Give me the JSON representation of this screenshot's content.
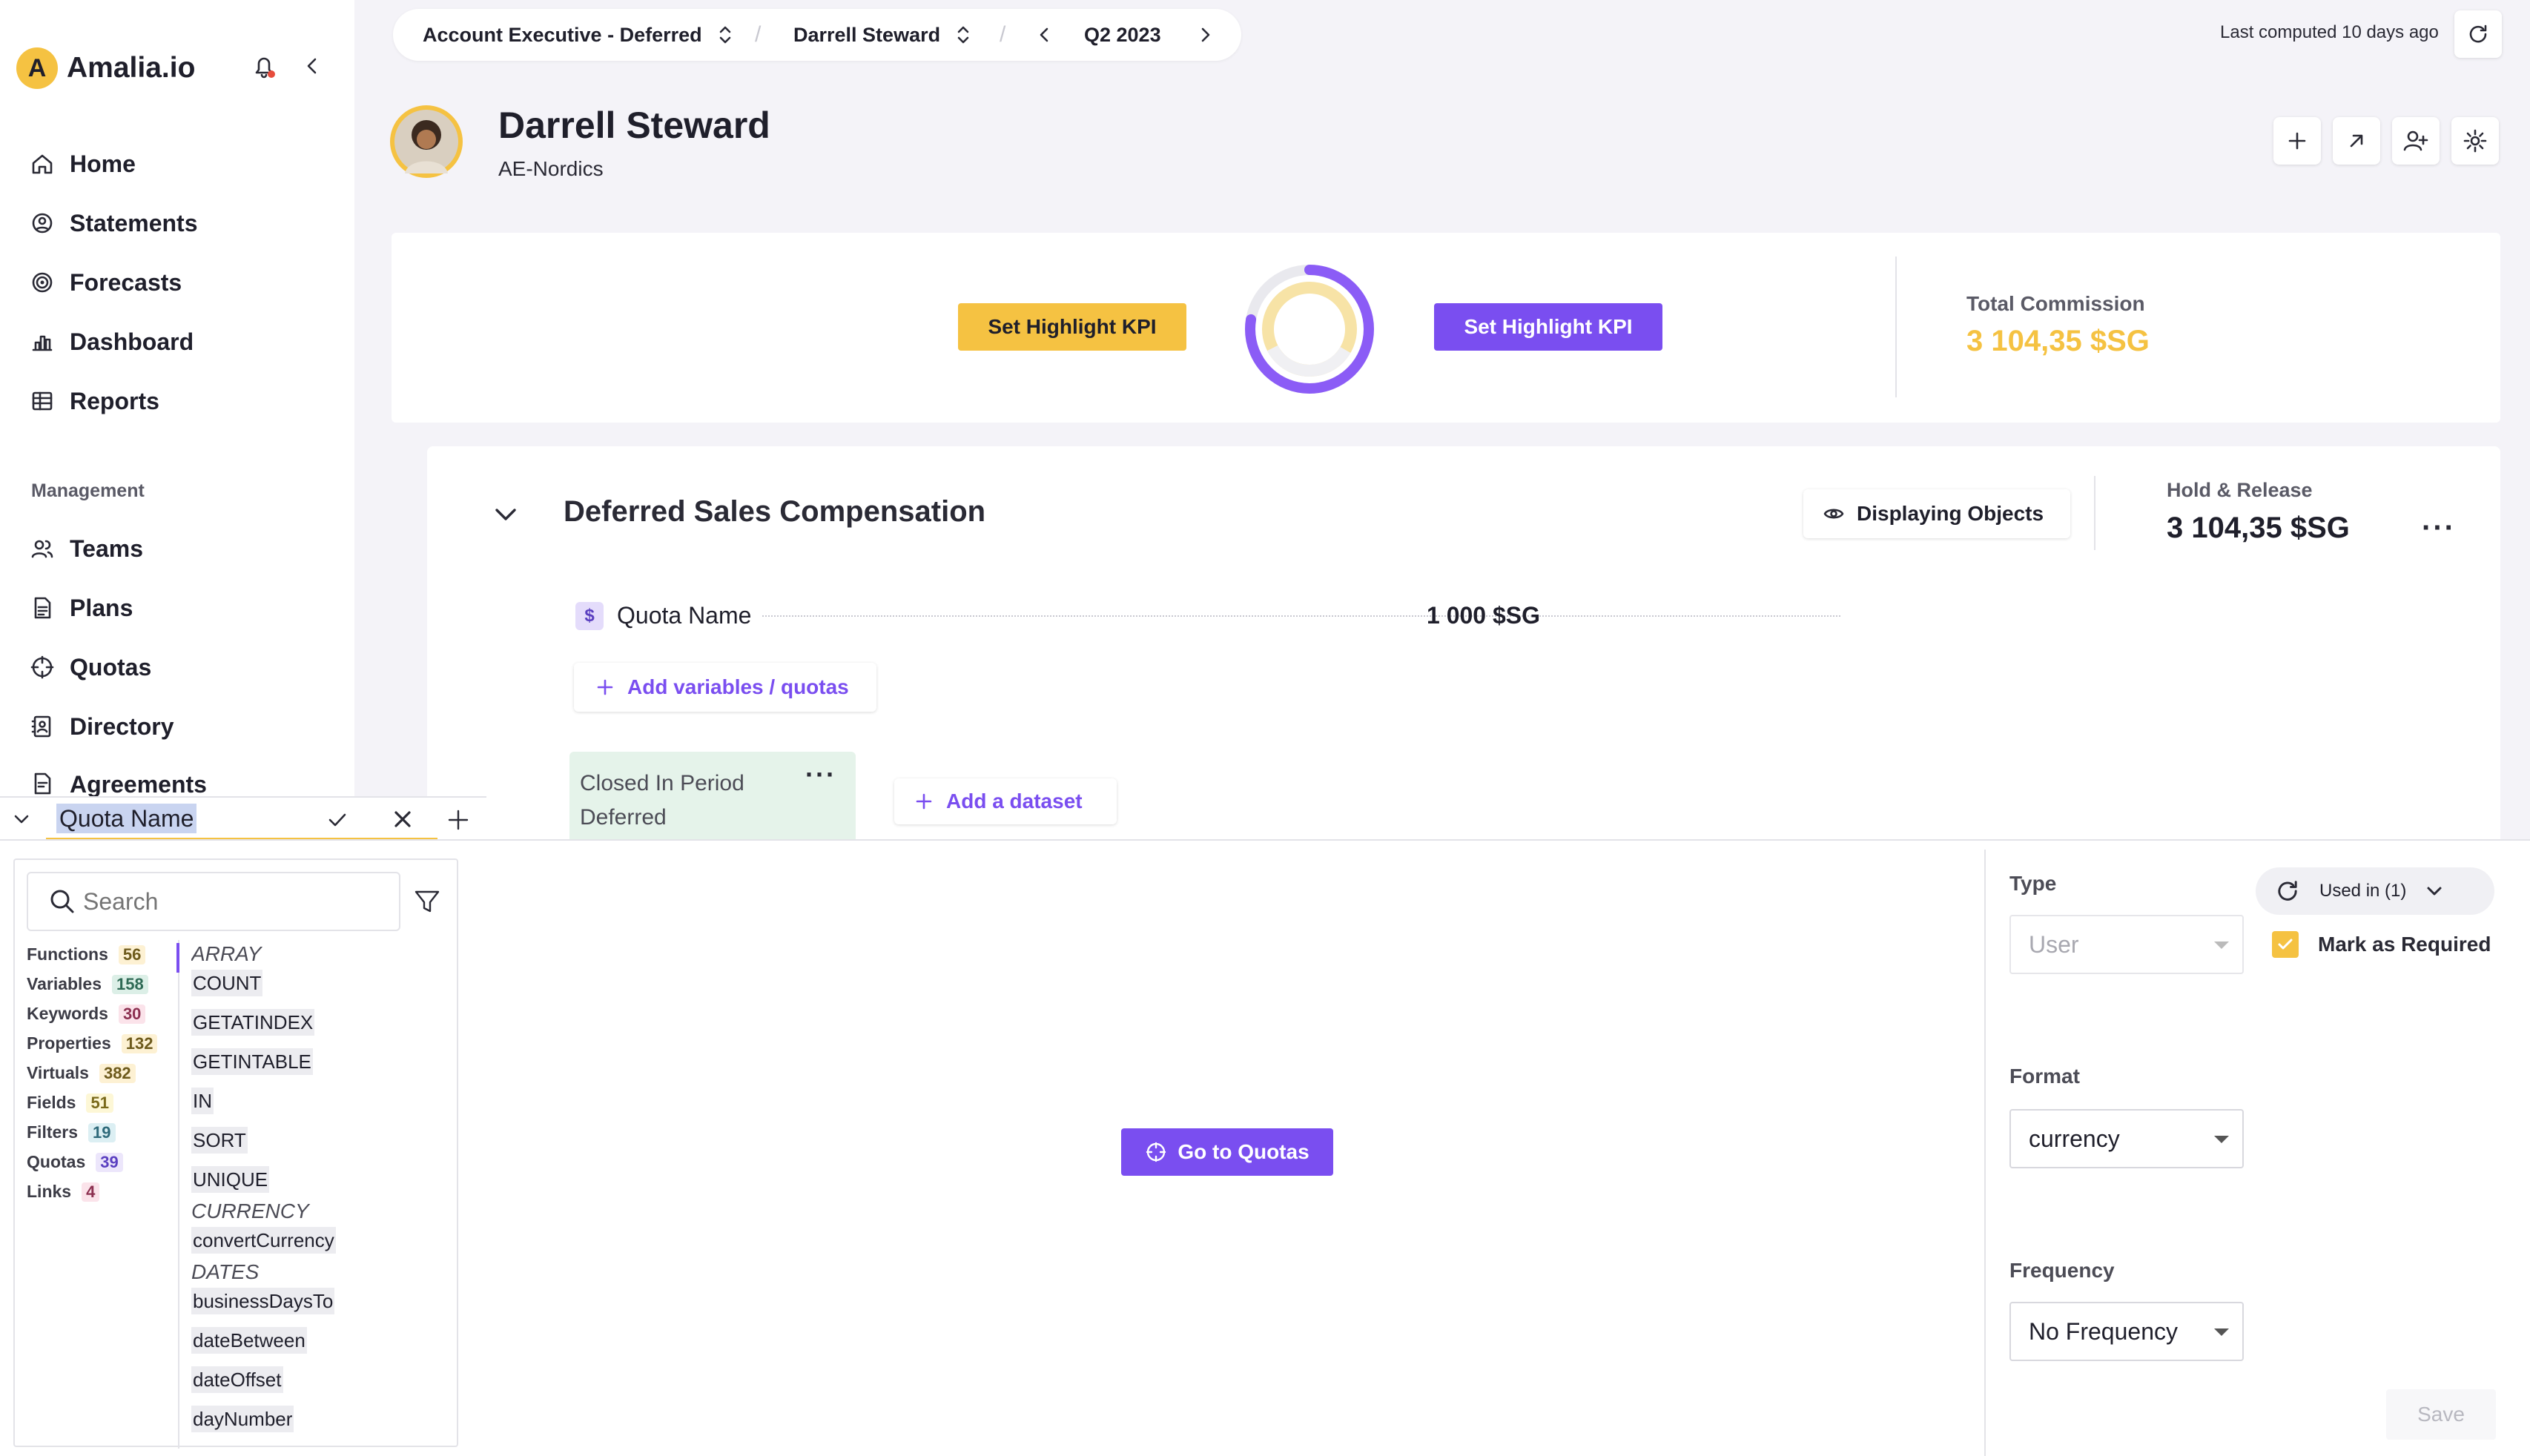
{
  "app": {
    "name": "Amalia.io",
    "logo_letter": "A",
    "accent": "#f5c242",
    "primary": "#7a4ef0"
  },
  "sidebar": {
    "items": [
      {
        "label": "Home",
        "icon": "home-icon"
      },
      {
        "label": "Statements",
        "icon": "user-circle-icon"
      },
      {
        "label": "Forecasts",
        "icon": "forecast-icon"
      },
      {
        "label": "Dashboard",
        "icon": "bar-chart-icon"
      },
      {
        "label": "Reports",
        "icon": "table-icon"
      }
    ],
    "section_label": "Management",
    "management_items": [
      {
        "label": "Teams",
        "icon": "users-icon"
      },
      {
        "label": "Plans",
        "icon": "document-icon"
      },
      {
        "label": "Quotas",
        "icon": "target-icon"
      },
      {
        "label": "Directory",
        "icon": "contacts-icon"
      },
      {
        "label": "Agreements",
        "icon": "agreement-icon"
      }
    ]
  },
  "topbar": {
    "plan": "Account Executive - Deferred",
    "user": "Darrell Steward",
    "period": "Q2 2023",
    "last_computed": "Last computed 10 days ago"
  },
  "header": {
    "name": "Darrell Steward",
    "team": "AE-Nordics"
  },
  "kpi": {
    "set_kpi_left": "Set Highlight KPI",
    "set_kpi_right": "Set Highlight KPI",
    "total_commission_label": "Total Commission",
    "total_commission_value": "3 104,35 $SG"
  },
  "plan_card": {
    "title": "Deferred Sales Compensation",
    "displaying_objects": "Displaying Objects",
    "hold_release_label": "Hold & Release",
    "hold_release_value": "3 104,35 $SG",
    "quota_icon": "$",
    "quota_name": "Quota Name",
    "quota_value": "1 000 $SG",
    "add_variables": "Add variables / quotas",
    "dataset_title": "Closed In Period Deferred",
    "add_dataset": "Add a dataset"
  },
  "editor": {
    "tab_name": "Quota Name",
    "search_placeholder": "Search",
    "categories": [
      {
        "label": "Functions",
        "count": "56"
      },
      {
        "label": "Variables",
        "count": "158"
      },
      {
        "label": "Keywords",
        "count": "30"
      },
      {
        "label": "Properties",
        "count": "132"
      },
      {
        "label": "Virtuals",
        "count": "382"
      },
      {
        "label": "Fields",
        "count": "51"
      },
      {
        "label": "Filters",
        "count": "19"
      },
      {
        "label": "Quotas",
        "count": "39"
      },
      {
        "label": "Links",
        "count": "4"
      }
    ],
    "groups": [
      {
        "label": "ARRAY",
        "items": [
          "COUNT",
          "GETATINDEX",
          "GETINTABLE",
          "IN",
          "SORT",
          "UNIQUE"
        ]
      },
      {
        "label": "CURRENCY",
        "items": [
          "convertCurrency"
        ]
      },
      {
        "label": "DATES",
        "items": [
          "businessDaysTo",
          "dateBetween",
          "dateOffset",
          "dayNumber"
        ]
      }
    ],
    "go_to_quotas": "Go to Quotas",
    "type_label": "Type",
    "type_value": "User",
    "used_in": "Used in (1)",
    "mark_required": "Mark as Required",
    "format_label": "Format",
    "format_value": "currency",
    "frequency_label": "Frequency",
    "frequency_value": "No Frequency",
    "save": "Save"
  }
}
